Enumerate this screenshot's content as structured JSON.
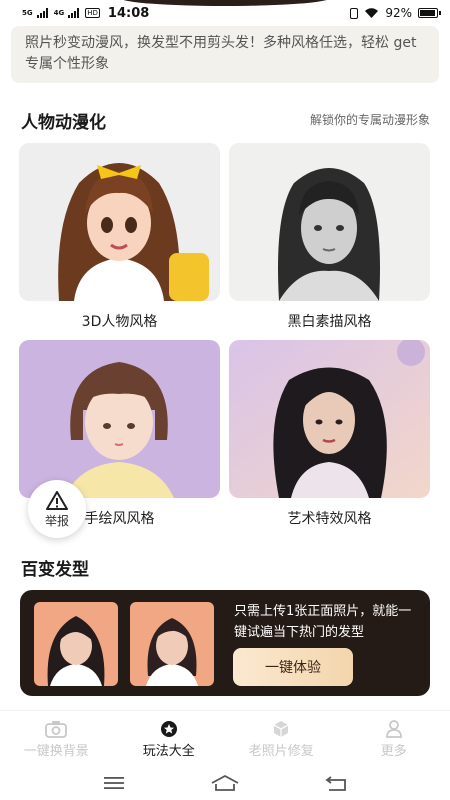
{
  "status_bar": {
    "network_1": "5G",
    "network_2": "4G",
    "hd": "HD",
    "time": "14:08",
    "battery": "92%",
    "battery_level": 0.92
  },
  "notice": {
    "text": "照片秒变动漫风，换发型不用剪头发！多种风格任选，轻松 get 专属个性形象"
  },
  "anime_section": {
    "title": "人物动漫化",
    "subtitle": "解锁你的专属动漫形象",
    "cards": [
      {
        "label": "3D人物风格"
      },
      {
        "label": "黑白素描风格"
      },
      {
        "label": "手绘风风格"
      },
      {
        "label": "艺术特效风格"
      }
    ]
  },
  "report": {
    "label": "举报"
  },
  "hairstyle_section": {
    "title": "百变发型",
    "banner_text": "只需上传1张正面照片，就能一键试遍当下热门的发型",
    "button": "一键体验"
  },
  "bottom_nav": [
    {
      "label": "一键换背景",
      "icon": "camera-icon",
      "active": false
    },
    {
      "label": "玩法大全",
      "icon": "star-icon",
      "active": true
    },
    {
      "label": "老照片修复",
      "icon": "cube-icon",
      "active": false
    },
    {
      "label": "更多",
      "icon": "user-icon",
      "active": false
    }
  ],
  "colors": {
    "banner_bg": "#241a16",
    "button_gradient": [
      "#fbe9d0",
      "#f3d5ad"
    ],
    "active_nav": "#1a1a1a",
    "inactive_nav": "#c8c8c8"
  }
}
